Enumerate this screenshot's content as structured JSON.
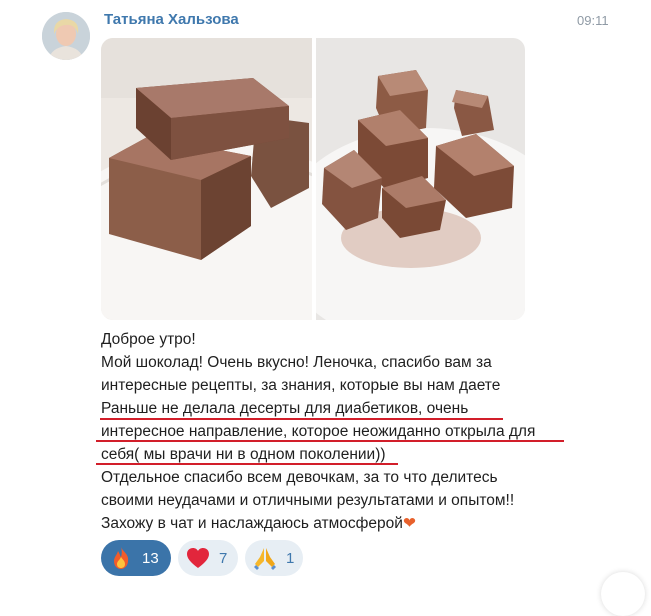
{
  "message": {
    "author": "Татьяна Хальзова",
    "time": "09:11",
    "lines": [
      "Доброе утро!",
      "Мой шоколад! Очень вкусно! Леночка, спасибо вам за",
      "интересные рецепты, за знания, которые вы нам даете",
      "Раньше не делала десерты для диабетиков, очень",
      "интересное направление, которое неожиданно открыла для",
      "себя( мы врачи ни в одном поколении))",
      "Отдельное спасибо всем девочкам, за то что делитесь",
      "своими неудачами и отличными результатами и опытом!!",
      "Захожу в чат и наслаждаюсь атмосферой"
    ],
    "trailing_emoji": "❤"
  },
  "photos": [
    {
      "icon": "chocolate-bars-photo"
    },
    {
      "icon": "cocoa-truffles-photo"
    }
  ],
  "reactions": [
    {
      "icon": "fire-icon",
      "count": "13",
      "selected": true
    },
    {
      "icon": "heart-icon",
      "count": "7",
      "selected": false
    },
    {
      "icon": "praying-hands-icon",
      "count": "1",
      "selected": false
    }
  ],
  "colors": {
    "author": "#3f78ad",
    "underline": "#d21e2a",
    "reaction_active": "#3b74a9",
    "reaction_idle": "#e7eef4"
  }
}
